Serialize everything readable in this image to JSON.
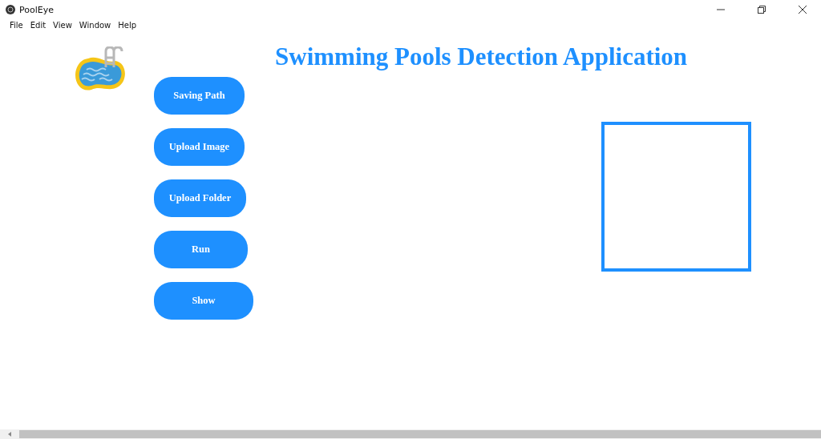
{
  "window": {
    "title": "PoolEye"
  },
  "menu": [
    "File",
    "Edit",
    "View",
    "Window",
    "Help"
  ],
  "heading": "Swimming Pools Detection Application",
  "buttons": [
    "Saving Path",
    "Upload Image",
    "Upload Folder",
    "Run",
    "Show"
  ],
  "preview": {
    "kind": "empty"
  }
}
